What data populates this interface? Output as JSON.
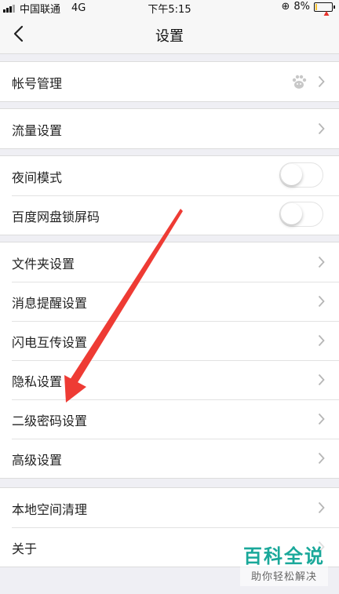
{
  "status_bar": {
    "carrier": "中国联通",
    "network": "4G",
    "time": "下午5:15",
    "battery_text": "8%",
    "battery_level": 0.08,
    "battery_color": "#f6c12e"
  },
  "navbar": {
    "title": "设置",
    "back_icon": "chevron-left-icon"
  },
  "groups": [
    {
      "rows": [
        {
          "label": "帐号管理",
          "accessory": "chevron",
          "extra_icon": "baidu-paw-icon"
        }
      ]
    },
    {
      "rows": [
        {
          "label": "流量设置",
          "accessory": "chevron"
        }
      ]
    },
    {
      "rows": [
        {
          "label": "夜间模式",
          "accessory": "toggle",
          "on": false
        },
        {
          "label": "百度网盘锁屏码",
          "accessory": "toggle",
          "on": false
        }
      ]
    },
    {
      "rows": [
        {
          "label": "文件夹设置",
          "accessory": "chevron"
        },
        {
          "label": "消息提醒设置",
          "accessory": "chevron"
        },
        {
          "label": "闪电互传设置",
          "accessory": "chevron"
        },
        {
          "label": "隐私设置",
          "accessory": "chevron"
        },
        {
          "label": "二级密码设置",
          "accessory": "chevron"
        },
        {
          "label": "高级设置",
          "accessory": "chevron"
        }
      ]
    },
    {
      "rows": [
        {
          "label": "本地空间清理",
          "accessory": "chevron"
        },
        {
          "label": "关于",
          "accessory": "chevron"
        }
      ]
    }
  ],
  "annotation": {
    "type": "red-arrow",
    "color": "#ee3b34",
    "points_to": "二级密码设置"
  },
  "watermark": {
    "title": "百科全说",
    "subtitle": "助你轻松解决",
    "color": "#1aa89a"
  }
}
